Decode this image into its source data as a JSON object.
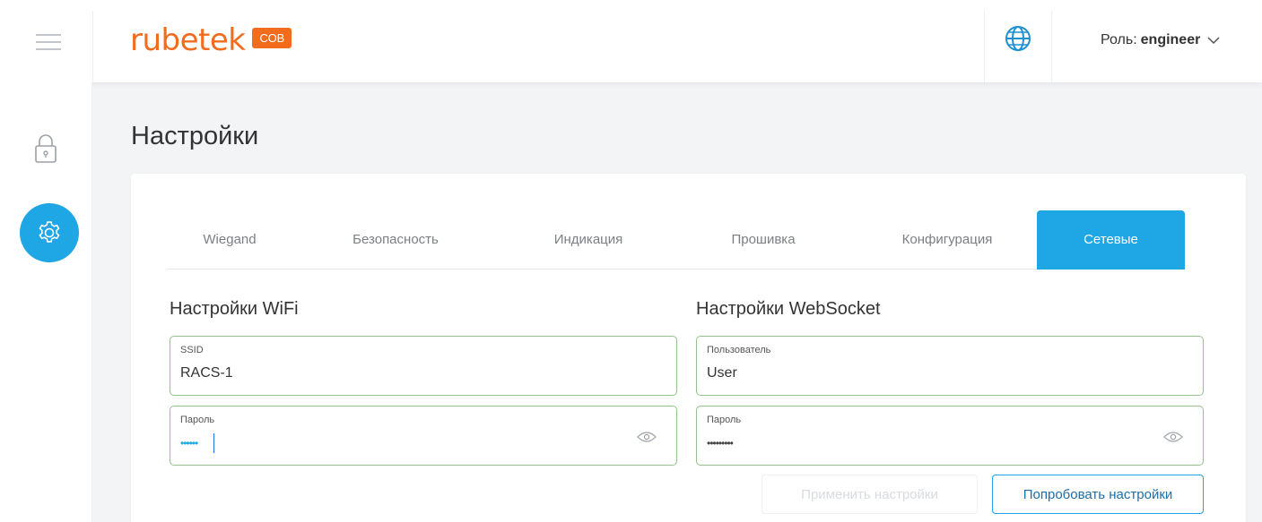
{
  "header": {
    "logo_text": "rubetek",
    "logo_badge": "СОВ",
    "role_label": "Роль:",
    "role_value": "engineer"
  },
  "page": {
    "title": "Настройки"
  },
  "tabs": [
    {
      "label": "Wiegand",
      "active": false
    },
    {
      "label": "Безопасность",
      "active": false
    },
    {
      "label": "Индикация",
      "active": false
    },
    {
      "label": "Прошивка",
      "active": false
    },
    {
      "label": "Конфигурация",
      "active": false
    },
    {
      "label": "Сетевые",
      "active": true
    }
  ],
  "wifi": {
    "title": "Настройки WiFi",
    "ssid_label": "SSID",
    "ssid_value": "RACS-1",
    "password_label": "Пароль",
    "password_value": "••••••"
  },
  "websocket": {
    "title": "Настройки WebSocket",
    "user_label": "Пользователь",
    "user_value": "User",
    "password_label": "Пароль",
    "password_value": "•••••••••"
  },
  "buttons": {
    "apply_label": "Применить настройки",
    "try_label": "Попробовать настройки"
  },
  "colors": {
    "accent": "#1ea7e4",
    "brand": "#f26c1d",
    "field_border": "#93c28a"
  }
}
